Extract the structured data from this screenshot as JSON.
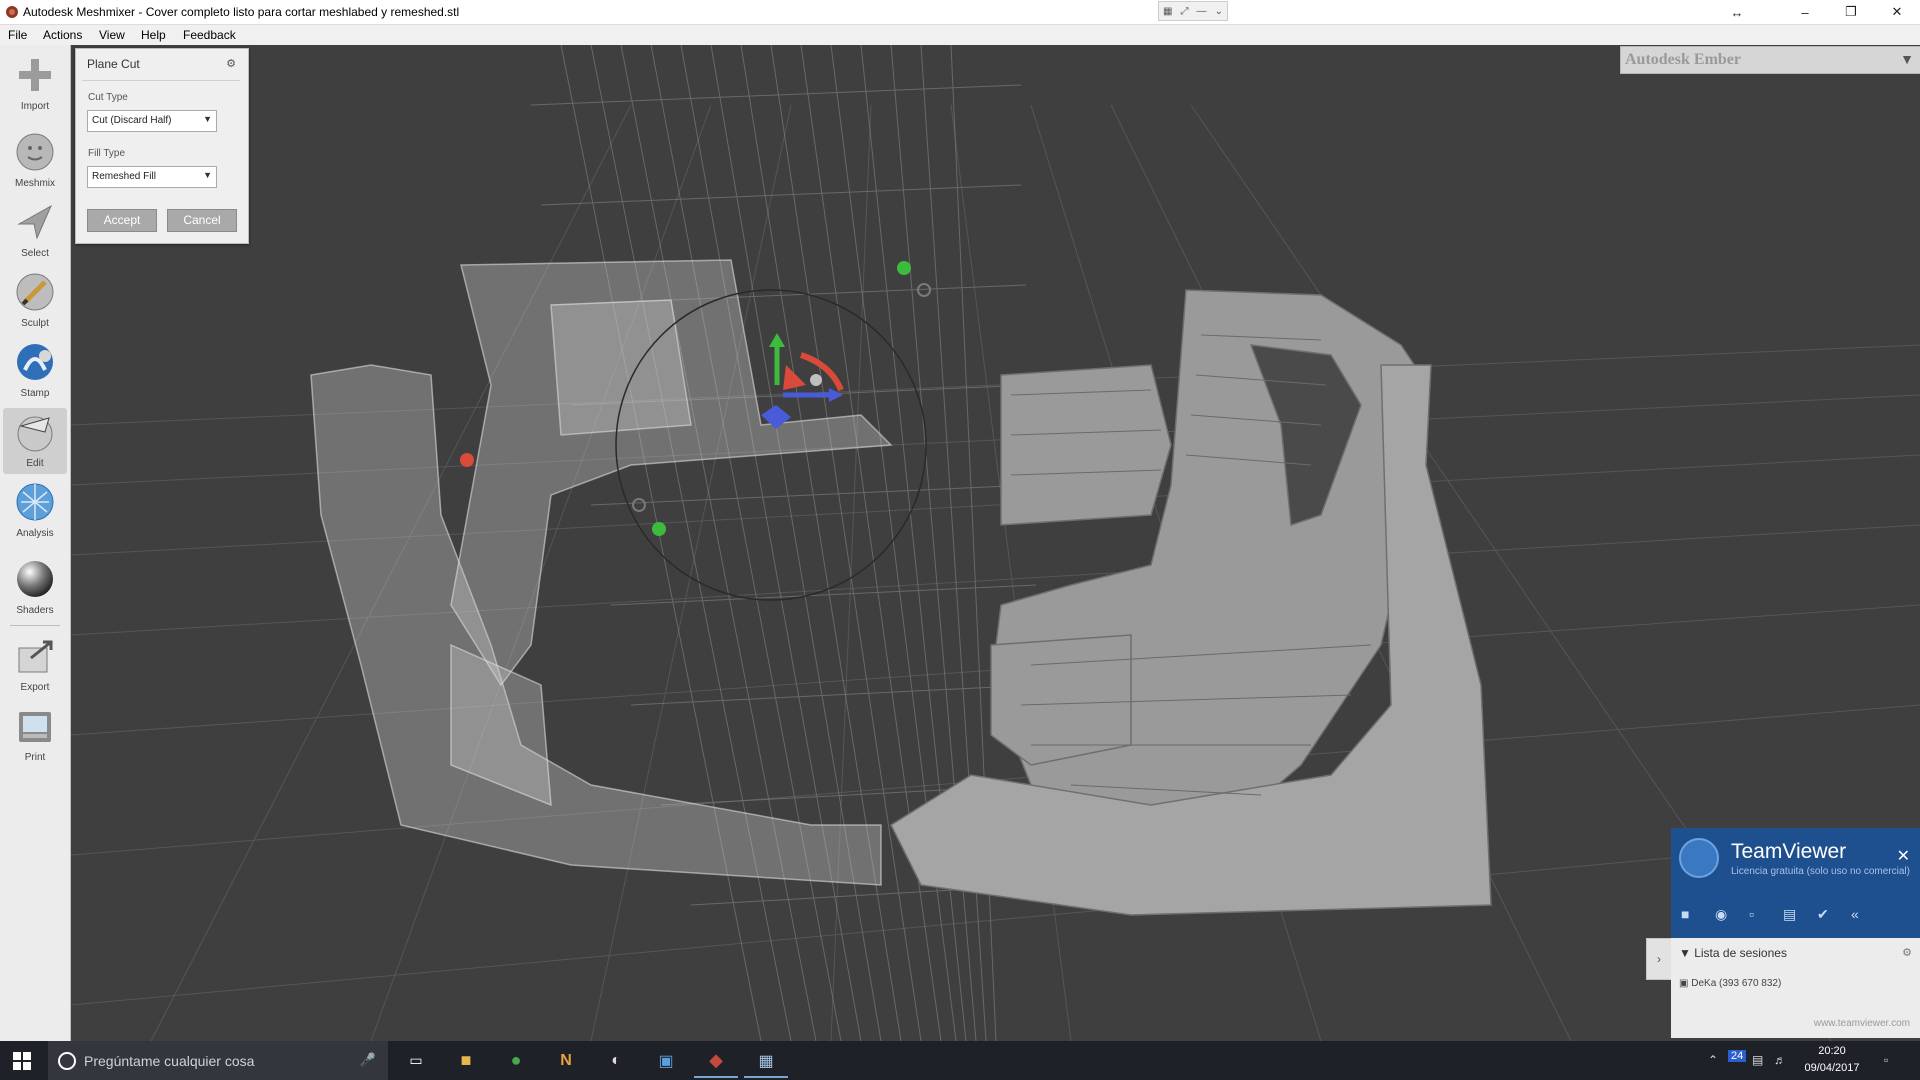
{
  "window": {
    "title": "Autodesk Meshmixer - Cover completo listo para cortar meshlabed y remeshed.stl",
    "minimize": "–",
    "maximize": "❐",
    "close": "✕",
    "resize": "↔"
  },
  "menu": [
    "File",
    "Actions",
    "View",
    "Help",
    "Feedback"
  ],
  "tools": [
    {
      "label": "Import",
      "icon": "import-icon"
    },
    {
      "label": "Meshmix",
      "icon": "meshmix-icon"
    },
    {
      "label": "Select",
      "icon": "select-icon"
    },
    {
      "label": "Sculpt",
      "icon": "sculpt-icon"
    },
    {
      "label": "Stamp",
      "icon": "stamp-icon"
    },
    {
      "label": "Edit",
      "icon": "edit-icon",
      "active": true
    },
    {
      "label": "Analysis",
      "icon": "analysis-icon"
    },
    {
      "label": "Shaders",
      "icon": "shaders-icon"
    },
    {
      "label": "Export",
      "icon": "export-icon"
    },
    {
      "label": "Print",
      "icon": "print-icon"
    }
  ],
  "plane_cut": {
    "title": "Plane Cut",
    "cut_type_label": "Cut Type",
    "cut_type_value": "Cut (Discard Half)",
    "fill_type_label": "Fill Type",
    "fill_type_value": "Remeshed Fill",
    "accept": "Accept",
    "cancel": "Cancel"
  },
  "ember": {
    "title": "Autodesk Ember"
  },
  "teamviewer": {
    "name": "TeamViewer",
    "subtitle": "Licencia gratuita (solo uso no comercial)",
    "close": "✕",
    "sessions_title": "Lista de sesiones",
    "session": "DeKa (393 670 832)",
    "url": "www.teamviewer.com"
  },
  "taskbar": {
    "search_placeholder": "Pregúntame cualquier cosa",
    "time": "20:20",
    "date": "09/04/2017",
    "badge": "24"
  },
  "colors": {
    "viewport_bg": "#3f3f3f",
    "grid": "#5e5e5e",
    "mesh": "#9a9a9a",
    "ghost_mesh": "#d0d0d0",
    "gizmo_red": "#d94a3b",
    "gizmo_green": "#3dbb3d",
    "gizmo_blue": "#4a5bd9",
    "teamviewer_blue": "#1e4f8e"
  }
}
